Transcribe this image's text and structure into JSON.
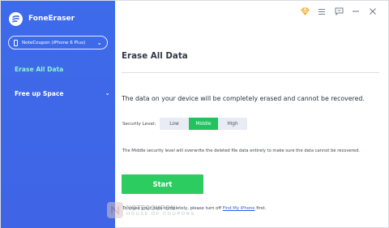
{
  "app": {
    "name": "FoneEraser"
  },
  "device": {
    "label": "NoteCoupon (iPhone 6 Plus)"
  },
  "sidebar": {
    "items": [
      {
        "label": "Erase All Data"
      },
      {
        "label": "Free up Space"
      }
    ]
  },
  "titlebar": {
    "icons": [
      "diamond-icon",
      "menu-icon",
      "chat-icon",
      "minimize-icon",
      "close-icon"
    ]
  },
  "main": {
    "title": "Erase All Data",
    "warning": "The data on your device will be completely erased and cannot be recovered.",
    "security": {
      "label": "Security Level:",
      "options": [
        "Low",
        "Middle",
        "High"
      ],
      "selected": "Middle"
    },
    "note": "The Middle security level will overwrite the deleted file data entirely to make sure the data cannot be recovered.",
    "start_label": "Start",
    "tip_prefix": "To erase your data completely, please turn off ",
    "tip_link": "Find My iPhone",
    "tip_suffix": " first."
  },
  "watermark": {
    "line1": "NOTECOUPON",
    "line2": "HOUSE OF COUPONS"
  },
  "colors": {
    "sidebar": "#3d6bea",
    "active_nav": "#8ef3d0",
    "accent_green": "#22c25f",
    "start": "#2ccc61",
    "link": "#2f5de6"
  }
}
